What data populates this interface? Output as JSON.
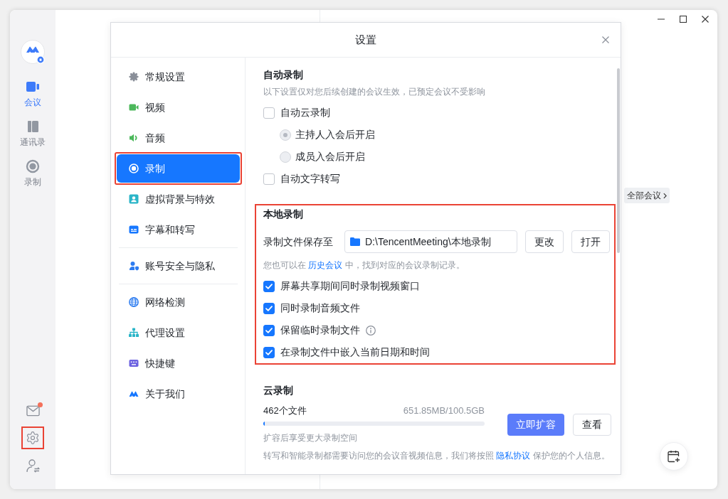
{
  "sidebar": {
    "nav": [
      {
        "label": "会议",
        "selected": true
      },
      {
        "label": "通讯录",
        "selected": false
      },
      {
        "label": "录制",
        "selected": false
      }
    ],
    "bottom": [
      {
        "badge": true,
        "highlighted": false
      },
      {
        "badge": false,
        "highlighted": true
      },
      {
        "badge": false,
        "highlighted": false
      }
    ]
  },
  "main": {
    "all_meetings_button": "全部会议"
  },
  "dialog": {
    "title": "设置",
    "nav_groups": [
      {
        "items": [
          {
            "label": "常规设置",
            "selected": false,
            "highlighted": false
          },
          {
            "label": "视频",
            "selected": false,
            "highlighted": false
          },
          {
            "label": "音频",
            "selected": false,
            "highlighted": false
          },
          {
            "label": "录制",
            "selected": true,
            "highlighted": true
          },
          {
            "label": "虚拟背景与特效",
            "selected": false,
            "highlighted": false
          },
          {
            "label": "字幕和转写",
            "selected": false,
            "highlighted": false
          }
        ]
      },
      {
        "items": [
          {
            "label": "账号安全与隐私",
            "selected": false,
            "highlighted": false
          }
        ]
      },
      {
        "items": [
          {
            "label": "网络检测",
            "selected": false,
            "highlighted": false
          },
          {
            "label": "代理设置",
            "selected": false,
            "highlighted": false
          },
          {
            "label": "快捷键",
            "selected": false,
            "highlighted": false
          },
          {
            "label": "关于我们",
            "selected": false,
            "highlighted": false
          }
        ]
      }
    ],
    "auto_recording": {
      "title": "自动录制",
      "highlighted": false,
      "note": "以下设置仅对您后续创建的会议生效，已预定会议不受影响",
      "options": [
        {
          "label": "自动云录制",
          "checked": false,
          "choices": [
            {
              "label": "主持人入会后开启",
              "selected": true,
              "disabled": true
            },
            {
              "label": "成员入会后开启",
              "selected": false,
              "disabled": true
            }
          ]
        },
        {
          "label": "自动文字转写",
          "checked": false
        }
      ]
    },
    "local_recording": {
      "title": "本地录制",
      "highlighted": true,
      "save_label": "录制文件保存至",
      "path": "D:\\TencentMeeting\\本地录制",
      "buttons": [
        "更改",
        "打开"
      ],
      "hint": {
        "before": "您也可以在 ",
        "link": "历史会议",
        "after": " 中，找到对应的会议录制记录。"
      },
      "options": [
        {
          "label": "屏幕共享期间同时录制视频窗口",
          "checked": true,
          "info": false
        },
        {
          "label": "同时录制音频文件",
          "checked": true,
          "info": false
        },
        {
          "label": "保留临时录制文件",
          "checked": true,
          "info": true
        },
        {
          "label": "在录制文件中嵌入当前日期和时间",
          "checked": true,
          "info": false
        }
      ]
    },
    "cloud_recording": {
      "title": "云录制",
      "highlighted": false,
      "file_count": "462个文件",
      "usage": "651.85MB/100.5GB",
      "level": 0.006,
      "expand_note": "扩容后享受更大录制空间",
      "buttons": [
        {
          "label": "立即扩容",
          "primary": true
        },
        {
          "label": "查看",
          "primary": false
        }
      ],
      "privacy": {
        "before": "转写和智能录制都需要访问您的会议音视频信息，我们将按照 ",
        "link": "隐私协议",
        "after": " 保护您的个人信息。"
      }
    }
  }
}
